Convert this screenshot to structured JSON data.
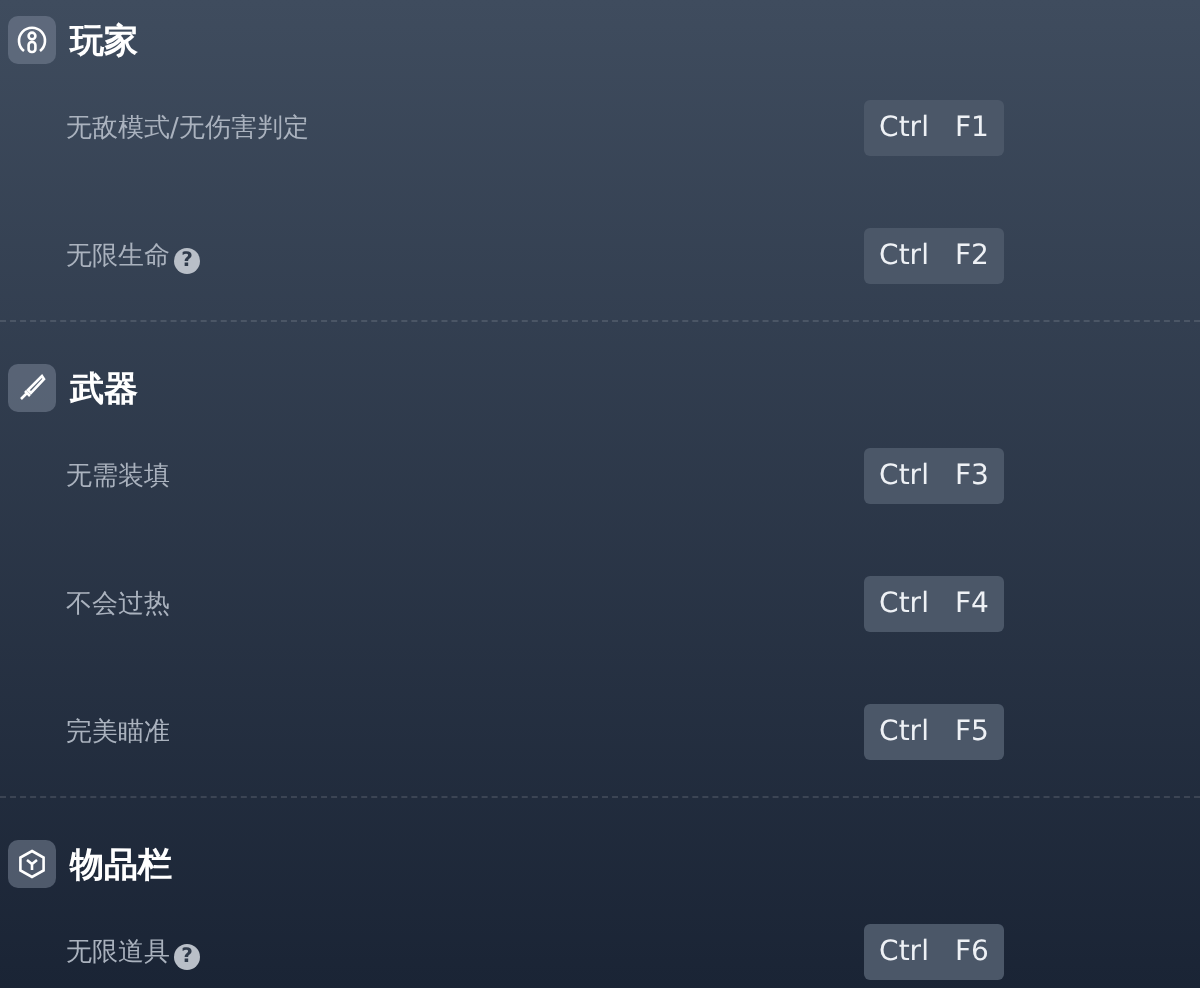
{
  "sections": [
    {
      "title": "玩家",
      "items": [
        {
          "label": "无敌模式/无伤害判定",
          "keys": [
            "Ctrl",
            "F1"
          ]
        },
        {
          "label": "无限生命",
          "help": "?",
          "keys": [
            "Ctrl",
            "F2"
          ]
        }
      ]
    },
    {
      "title": "武器",
      "items": [
        {
          "label": "无需装填",
          "keys": [
            "Ctrl",
            "F3"
          ]
        },
        {
          "label": "不会过热",
          "keys": [
            "Ctrl",
            "F4"
          ]
        },
        {
          "label": "完美瞄准",
          "keys": [
            "Ctrl",
            "F5"
          ]
        }
      ]
    },
    {
      "title": "物品栏",
      "items": [
        {
          "label": "无限道具",
          "help": "?",
          "keys": [
            "Ctrl",
            "F6"
          ]
        }
      ]
    }
  ]
}
